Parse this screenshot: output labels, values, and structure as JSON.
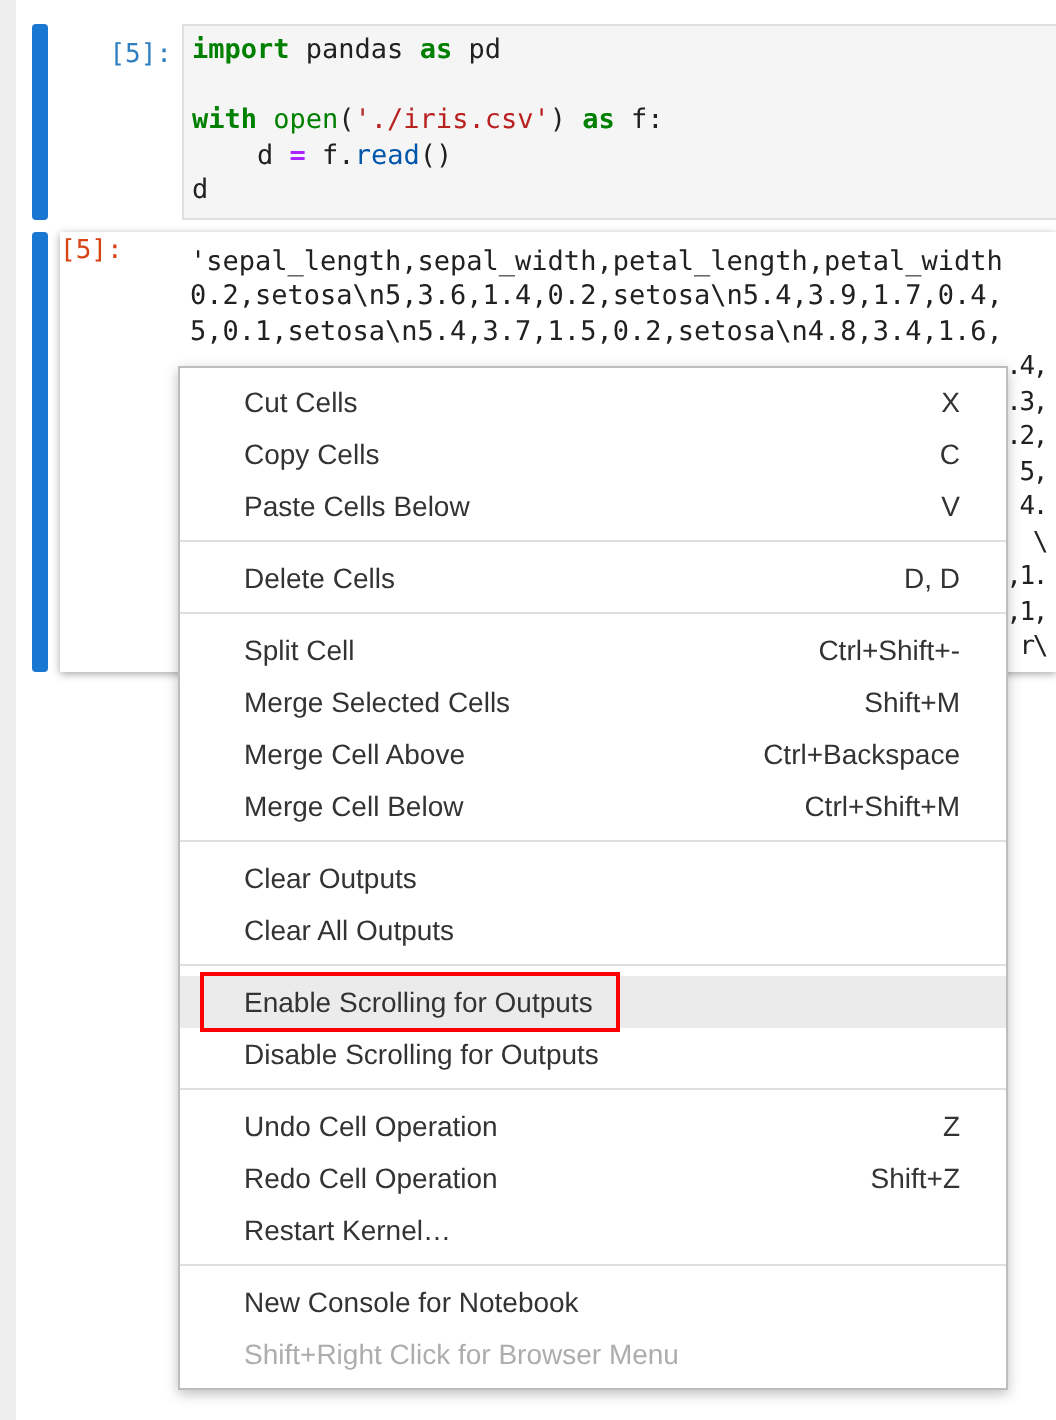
{
  "cells": [
    {
      "kind": "input",
      "prompt": "[5]:",
      "lines": [
        {
          "kind": "code",
          "tokens": [
            {
              "text": "import",
              "kind": "keyword"
            },
            {
              "text": " pandas ",
              "kind": "plain"
            },
            {
              "text": "as",
              "kind": "keyword"
            },
            {
              "text": " pd",
              "kind": "plain"
            }
          ]
        },
        {
          "kind": "blank"
        },
        {
          "kind": "code",
          "tokens": [
            {
              "text": "with ",
              "kind": "keyword"
            },
            {
              "text": "open",
              "kind": "builtin"
            },
            {
              "text": "(",
              "kind": "plain"
            },
            {
              "text": "'./iris.csv'",
              "kind": "string"
            },
            {
              "text": ") ",
              "kind": "plain"
            },
            {
              "text": "as",
              "kind": "keyword"
            },
            {
              "text": " f:",
              "kind": "plain"
            }
          ]
        },
        {
          "kind": "code",
          "tokens": [
            {
              "text": "    d ",
              "kind": "plain"
            },
            {
              "text": "=",
              "kind": "operator"
            },
            {
              "text": " f.",
              "kind": "plain"
            },
            {
              "text": "read",
              "kind": "method"
            },
            {
              "text": "()",
              "kind": "plain"
            }
          ]
        },
        {
          "kind": "code",
          "tokens": [
            {
              "text": "d",
              "kind": "plain"
            }
          ]
        }
      ]
    },
    {
      "kind": "output",
      "prompt": "[5]:",
      "text_lines": [
        "'sepal_length,sepal_width,petal_length,petal_width",
        "0.2,setosa\\n5,3.6,1.4,0.2,setosa\\n5.4,3.9,1.7,0.4,",
        "5,0.1,setosa\\n5.4,3.7,1.5,0.2,setosa\\n4.8,3.4,1.6,"
      ],
      "fragments": [
        ".4,",
        ".3,",
        ".2,",
        "5,",
        "4.",
        "\\",
        ",1.",
        ",1,",
        "r\\"
      ]
    }
  ],
  "context_menu": {
    "groups": [
      [
        {
          "label": "Cut Cells",
          "shortcut": "X",
          "selected": false,
          "disabled": false,
          "annotated": false
        },
        {
          "label": "Copy Cells",
          "shortcut": "C",
          "selected": false,
          "disabled": false,
          "annotated": false
        },
        {
          "label": "Paste Cells Below",
          "shortcut": "V",
          "selected": false,
          "disabled": false,
          "annotated": false
        }
      ],
      [
        {
          "label": "Delete Cells",
          "shortcut": "D, D",
          "selected": false,
          "disabled": false,
          "annotated": false
        }
      ],
      [
        {
          "label": "Split Cell",
          "shortcut": "Ctrl+Shift+-",
          "selected": false,
          "disabled": false,
          "annotated": false
        },
        {
          "label": "Merge Selected Cells",
          "shortcut": "Shift+M",
          "selected": false,
          "disabled": false,
          "annotated": false
        },
        {
          "label": "Merge Cell Above",
          "shortcut": "Ctrl+Backspace",
          "selected": false,
          "disabled": false,
          "annotated": false
        },
        {
          "label": "Merge Cell Below",
          "shortcut": "Ctrl+Shift+M",
          "selected": false,
          "disabled": false,
          "annotated": false
        }
      ],
      [
        {
          "label": "Clear Outputs",
          "selected": false,
          "disabled": false,
          "annotated": false
        },
        {
          "label": "Clear All Outputs",
          "selected": false,
          "disabled": false,
          "annotated": false
        }
      ],
      [
        {
          "label": "Enable Scrolling for Outputs",
          "selected": true,
          "disabled": false,
          "annotated": true
        },
        {
          "label": "Disable Scrolling for Outputs",
          "selected": false,
          "disabled": false,
          "annotated": false
        }
      ],
      [
        {
          "label": "Undo Cell Operation",
          "shortcut": "Z",
          "selected": false,
          "disabled": false,
          "annotated": false
        },
        {
          "label": "Redo Cell Operation",
          "shortcut": "Shift+Z",
          "selected": false,
          "disabled": false,
          "annotated": false
        },
        {
          "label": "Restart Kernel…",
          "selected": false,
          "disabled": false,
          "annotated": false
        }
      ],
      [
        {
          "label": "New Console for Notebook",
          "selected": false,
          "disabled": false,
          "annotated": false
        },
        {
          "label": "Shift+Right Click for Browser Menu",
          "selected": false,
          "disabled": true,
          "annotated": false
        }
      ]
    ]
  }
}
